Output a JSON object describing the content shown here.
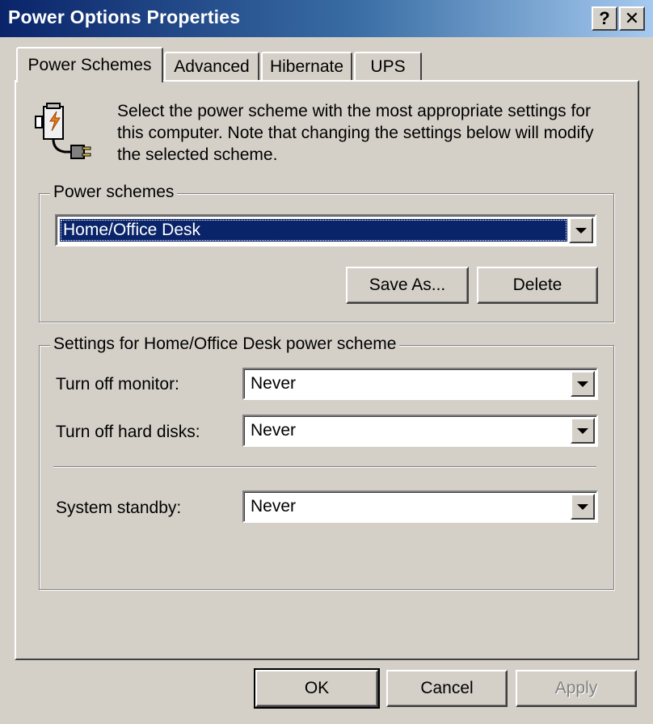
{
  "window": {
    "title": "Power Options Properties",
    "help_label": "?",
    "close_label": "✕"
  },
  "tabs": [
    {
      "label": "Power Schemes",
      "active": true
    },
    {
      "label": "Advanced",
      "active": false
    },
    {
      "label": "Hibernate",
      "active": false
    },
    {
      "label": "UPS",
      "active": false
    }
  ],
  "header": {
    "icon": "power-plug-icon",
    "description": "Select the power scheme with the most appropriate settings for this computer. Note that changing the settings below will modify the selected scheme."
  },
  "power_schemes": {
    "legend": "Power schemes",
    "selected": "Home/Office Desk",
    "save_as_label": "Save As...",
    "delete_label": "Delete"
  },
  "settings": {
    "legend": "Settings for Home/Office Desk power scheme",
    "turn_off_monitor": {
      "label": "Turn off monitor:",
      "value": "Never"
    },
    "turn_off_hard_disks": {
      "label": "Turn off hard disks:",
      "value": "Never"
    },
    "system_standby": {
      "label": "System standby:",
      "value": "Never"
    }
  },
  "footer": {
    "ok_label": "OK",
    "cancel_label": "Cancel",
    "apply_label": "Apply"
  },
  "colors": {
    "face": "#d4d0c8",
    "title_start": "#0a246a",
    "title_end": "#a6caf0",
    "selection": "#0a246a"
  }
}
